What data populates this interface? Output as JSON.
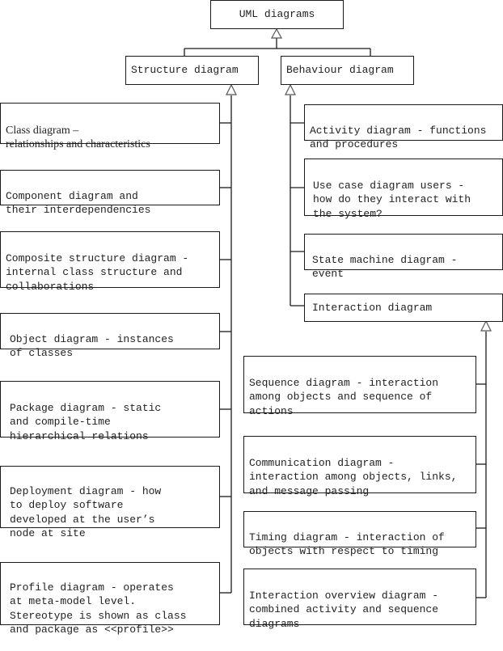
{
  "root": {
    "label": "UML diagrams"
  },
  "categories": {
    "structure": {
      "label": "Structure diagram"
    },
    "behaviour": {
      "label": "Behaviour diagram"
    }
  },
  "structure_items": [
    {
      "label": "Class diagram –\nrelationships and characteristics"
    },
    {
      "label": "Component diagram and\ntheir interdependencies"
    },
    {
      "label": "Composite structure diagram -\ninternal class structure and\ncollaborations"
    },
    {
      "label": "Object diagram - instances\nof classes"
    },
    {
      "label": "Package diagram - static\nand compile-time\nhierarchical relations"
    },
    {
      "label": "Deployment diagram - how\nto deploy software\ndeveloped at the user’s\nnode at site"
    },
    {
      "label": "Profile diagram - operates\nat meta-model level.\nStereotype is shown as class\nand package as <<profile>>"
    }
  ],
  "behaviour_items": [
    {
      "label": "Activity diagram - functions\nand procedures"
    },
    {
      "label": "Use case diagram users -\nhow do they interact with\nthe system?"
    },
    {
      "label": "State machine diagram -\nevent"
    },
    {
      "label": "Interaction diagram"
    }
  ],
  "interaction_items": [
    {
      "label": "Sequence diagram - interaction\namong objects and sequence of\nactions"
    },
    {
      "label": "Communication diagram -\ninteraction among objects, links,\nand message passing"
    },
    {
      "label": "Timing diagram - interaction of\nobjects with respect to timing"
    },
    {
      "label": "Interaction overview diagram -\ncombined activity and sequence\ndiagrams"
    }
  ]
}
